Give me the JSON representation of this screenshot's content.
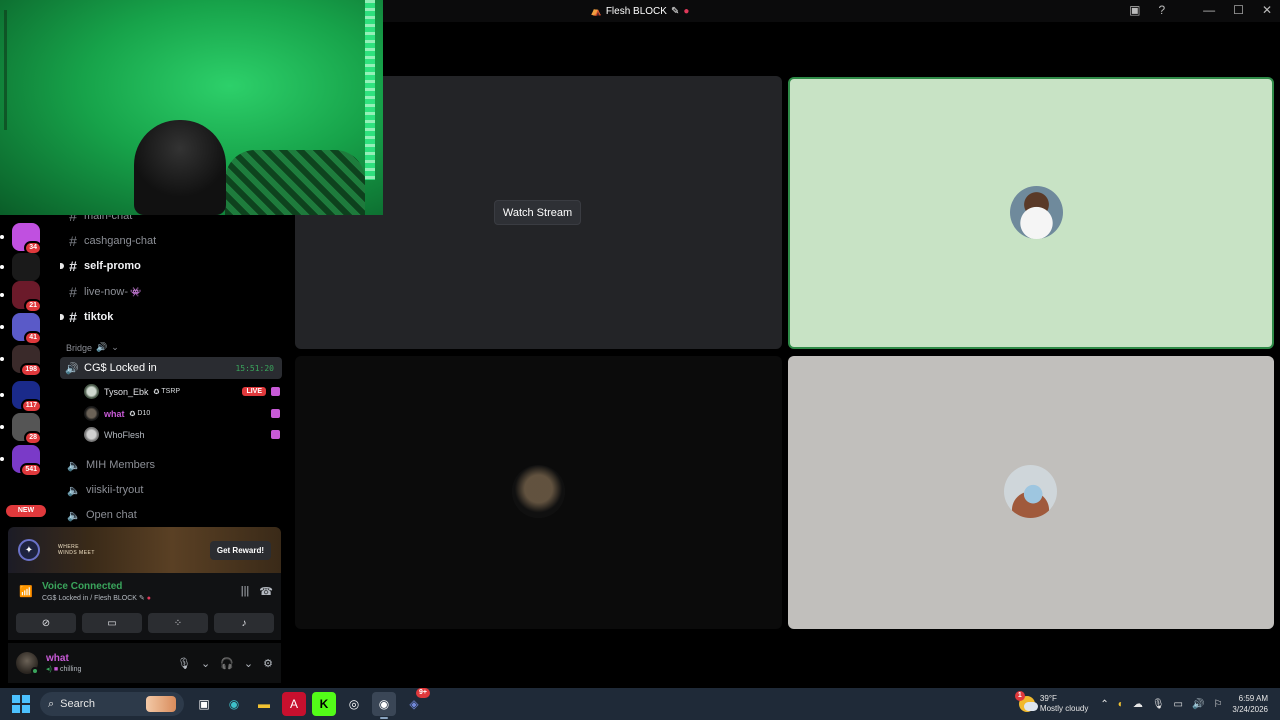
{
  "window": {
    "title": "Flesh BLOCK",
    "controls": [
      "inbox-icon",
      "help-icon",
      "minimize-icon",
      "maximize-icon",
      "close-icon"
    ]
  },
  "server_rail": {
    "servers": [
      {
        "badge": "34",
        "color": "#c050e0"
      },
      {
        "badge": "",
        "color": "#1a1a1a"
      },
      {
        "badge": "21",
        "color": "#6b1a2a"
      },
      {
        "badge": "41",
        "color": "#5a5ac8"
      },
      {
        "badge": "198",
        "color": "#3a2a2a"
      },
      {
        "badge": "117",
        "color": "#1a2a8a"
      },
      {
        "badge": "28",
        "color": "#555"
      },
      {
        "badge": "541",
        "color": "#7a3ac8"
      }
    ],
    "new_label": "NEW"
  },
  "channels": {
    "text": [
      {
        "name": "main-chat",
        "unread": false
      },
      {
        "name": "cashgang-chat",
        "unread": false
      },
      {
        "name": "self-promo",
        "unread": true
      },
      {
        "name": "live-now-",
        "unread": false
      },
      {
        "name": "tiktok",
        "unread": true
      }
    ],
    "category": "Bridge",
    "active_voice": {
      "name": "CG$ Locked in",
      "timer": "15:51:20"
    },
    "voice_users": [
      {
        "name": "Tyson_Ebk",
        "tag": "TSRP",
        "live": "LIVE"
      },
      {
        "name": "what",
        "tag": "D10",
        "live": ""
      },
      {
        "name": "WhoFlesh",
        "tag": "",
        "live": ""
      }
    ],
    "voice_channels": [
      "MIH Members",
      "viiskii-tryout",
      "Open chat"
    ]
  },
  "promo": {
    "logo_line1": "WHERE",
    "logo_line2": "WINDS MEET",
    "button": "Get Reward!"
  },
  "voice_panel": {
    "title": "Voice Connected",
    "subtitle": "CG$ Locked in / Flesh BLOCK"
  },
  "user_panel": {
    "name": "what",
    "status": "chilling"
  },
  "stage": {
    "watch_label": "Watch Stream"
  },
  "taskbar": {
    "search_placeholder": "Search",
    "weather_temp": "39°F",
    "weather_desc": "Mostly cloudy",
    "weather_alert": "1",
    "discord_badge": "9+",
    "time": "6:59 AM",
    "date": "3/24/2026"
  }
}
